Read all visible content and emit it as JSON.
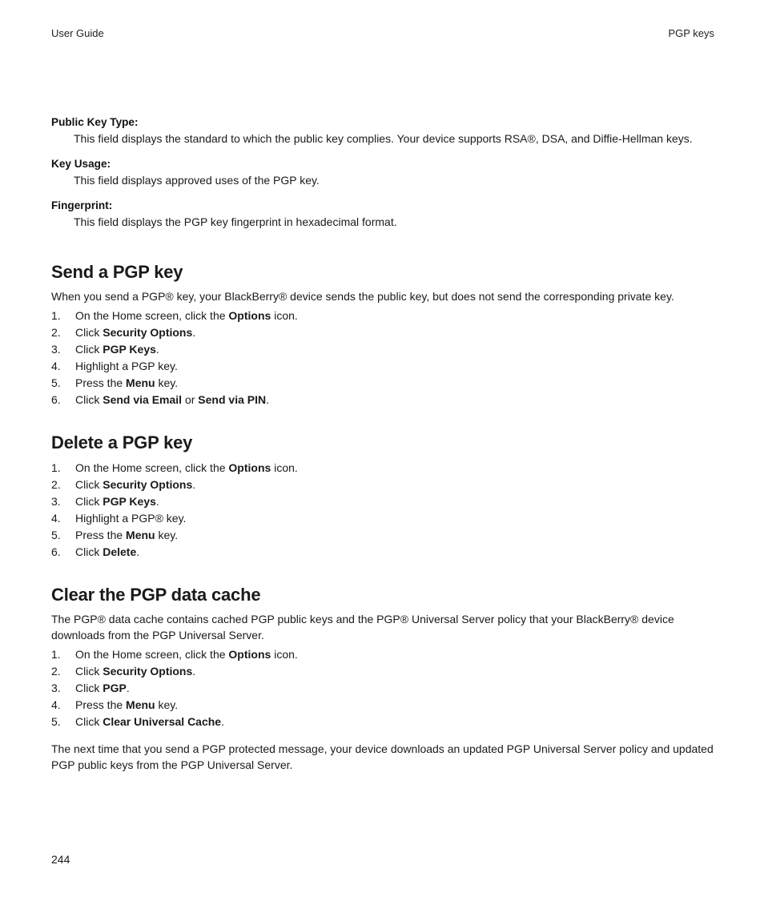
{
  "header": {
    "left": "User Guide",
    "right": "PGP keys"
  },
  "definitions": [
    {
      "term": "Public Key Type:",
      "desc": "This field displays the standard to which the public key complies. Your device supports RSA®, DSA, and Diffie-Hellman keys."
    },
    {
      "term": "Key Usage:",
      "desc": "This field displays approved uses of the PGP key."
    },
    {
      "term": "Fingerprint:",
      "desc": "This field displays the PGP key fingerprint in hexadecimal format."
    }
  ],
  "section_send": {
    "title": "Send a PGP key",
    "intro": "When you send a PGP® key, your BlackBerry® device sends the public key, but does not send the corresponding private key.",
    "steps": [
      [
        {
          "t": "On the Home screen, click the "
        },
        {
          "b": "Options"
        },
        {
          "t": " icon."
        }
      ],
      [
        {
          "t": "Click "
        },
        {
          "b": "Security Options"
        },
        {
          "t": "."
        }
      ],
      [
        {
          "t": "Click "
        },
        {
          "b": "PGP Keys"
        },
        {
          "t": "."
        }
      ],
      [
        {
          "t": "Highlight a PGP key."
        }
      ],
      [
        {
          "t": "Press the "
        },
        {
          "b": "Menu"
        },
        {
          "t": " key."
        }
      ],
      [
        {
          "t": "Click "
        },
        {
          "b": "Send via Email"
        },
        {
          "t": " or "
        },
        {
          "b": "Send via PIN"
        },
        {
          "t": "."
        }
      ]
    ]
  },
  "section_delete": {
    "title": "Delete a PGP key",
    "steps": [
      [
        {
          "t": "On the Home screen, click the "
        },
        {
          "b": "Options"
        },
        {
          "t": " icon."
        }
      ],
      [
        {
          "t": "Click "
        },
        {
          "b": "Security Options"
        },
        {
          "t": "."
        }
      ],
      [
        {
          "t": "Click "
        },
        {
          "b": "PGP Keys"
        },
        {
          "t": "."
        }
      ],
      [
        {
          "t": "Highlight a PGP® key."
        }
      ],
      [
        {
          "t": "Press the "
        },
        {
          "b": "Menu"
        },
        {
          "t": " key."
        }
      ],
      [
        {
          "t": "Click "
        },
        {
          "b": "Delete"
        },
        {
          "t": "."
        }
      ]
    ]
  },
  "section_clear": {
    "title": "Clear the PGP data cache",
    "intro": "The PGP® data cache contains cached PGP public keys and the PGP® Universal Server policy that your BlackBerry® device downloads from the PGP Universal Server.",
    "steps": [
      [
        {
          "t": "On the Home screen, click the "
        },
        {
          "b": "Options"
        },
        {
          "t": " icon."
        }
      ],
      [
        {
          "t": "Click "
        },
        {
          "b": "Security Options"
        },
        {
          "t": "."
        }
      ],
      [
        {
          "t": "Click "
        },
        {
          "b": "PGP"
        },
        {
          "t": "."
        }
      ],
      [
        {
          "t": "Press the "
        },
        {
          "b": "Menu"
        },
        {
          "t": " key."
        }
      ],
      [
        {
          "t": "Click "
        },
        {
          "b": "Clear Universal Cache"
        },
        {
          "t": "."
        }
      ]
    ],
    "trail": "The next time that you send a PGP protected message, your device downloads an updated PGP Universal Server policy and updated PGP public keys from the PGP Universal Server."
  },
  "page_number": "244"
}
